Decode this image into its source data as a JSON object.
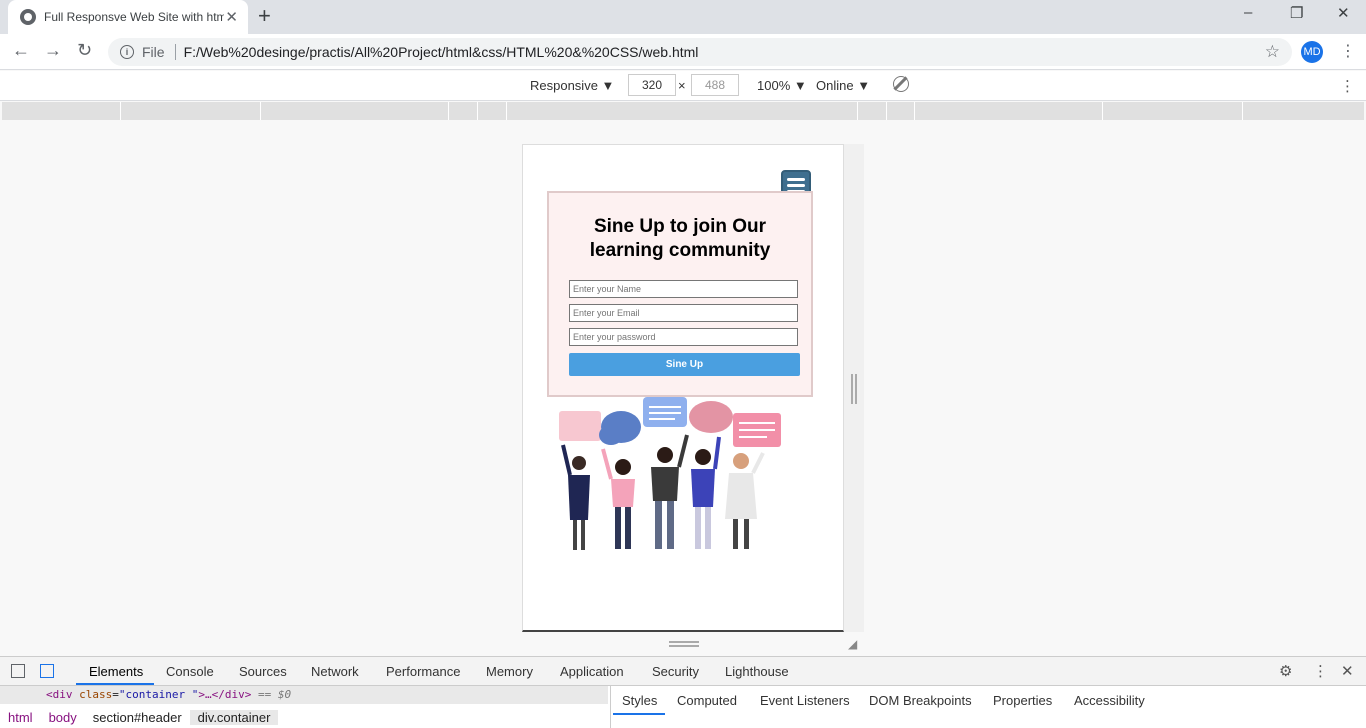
{
  "browser": {
    "tab_title": "Full Responsve Web Site with html",
    "new_tab": "+",
    "window_controls": [
      "–",
      "❐",
      "✕"
    ],
    "scheme": "File",
    "url": "F:/Web%20desinge/practis/All%20Project/html&css/HTML%20&%20CSS/web.html",
    "avatar_initials": "MD"
  },
  "device_toolbar": {
    "device": "Responsive ▼",
    "width": "320",
    "times": "×",
    "height": "488",
    "zoom": "100% ▼",
    "network": "Online ▼"
  },
  "page": {
    "form_title_line1": "Sine Up to join Our",
    "form_title_line2": "learning community",
    "name_placeholder": "Enter your Name",
    "email_placeholder": "Enter your Email",
    "password_placeholder": "Enter your password",
    "submit_label": "Sine Up"
  },
  "devtools": {
    "tabs": [
      "Elements",
      "Console",
      "Sources",
      "Network",
      "Performance",
      "Memory",
      "Application",
      "Security",
      "Lighthouse"
    ],
    "code_line": {
      "open": "<div",
      "attr": "class",
      "value": "\"container \"",
      "rest": ">…</div>",
      "eq": "== $0"
    },
    "breadcrumbs": [
      "html",
      "body",
      "section#header",
      "div.container"
    ],
    "style_tabs": [
      "Styles",
      "Computed",
      "Event Listeners",
      "DOM Breakpoints",
      "Properties",
      "Accessibility"
    ]
  },
  "colors": {
    "accent": "#1a73e8",
    "button": "#4a9fe0",
    "card_bg": "#fdf1f1",
    "hamburger": "#3f6f8f"
  }
}
